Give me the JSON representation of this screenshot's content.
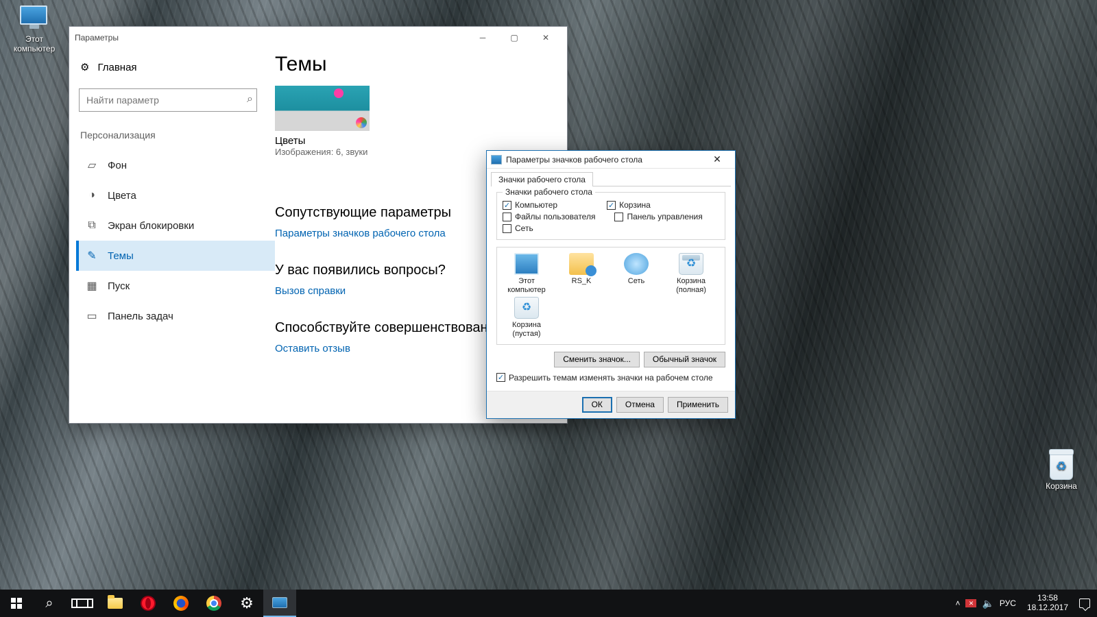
{
  "desktop": {
    "this_pc": "Этот\nкомпьютер",
    "recycle": "Корзина"
  },
  "settings": {
    "title": "Параметры",
    "home": "Главная",
    "search_placeholder": "Найти параметр",
    "category": "Персонализация",
    "nav": {
      "background": "Фон",
      "colors": "Цвета",
      "lockscreen": "Экран блокировки",
      "themes": "Темы",
      "start": "Пуск",
      "taskbar": "Панель задач"
    },
    "main": {
      "heading": "Темы",
      "theme_name": "Цветы",
      "theme_sub": "Изображения: 6, звуки",
      "related_h": "Сопутствующие параметры",
      "related_link": "Параметры значков рабочего стола",
      "help_h": "У вас появились вопросы?",
      "help_link": "Вызов справки",
      "feedback_h": "Способствуйте совершенствованию…",
      "feedback_link": "Оставить отзыв"
    }
  },
  "dialog": {
    "title": "Параметры значков рабочего стола",
    "tab": "Значки рабочего стола",
    "group_title": "Значки рабочего стола",
    "checks": {
      "computer": "Компьютер",
      "recycle": "Корзина",
      "userfiles": "Файлы пользователя",
      "cpl": "Панель управления",
      "network": "Сеть"
    },
    "icons": {
      "pc": "Этот\nкомпьютер",
      "user": "RS_K",
      "net": "Сеть",
      "bin_full": "Корзина\n(полная)",
      "bin_empty": "Корзина\n(пустая)"
    },
    "btn_change": "Сменить значок...",
    "btn_default": "Обычный значок",
    "allow_themes": "Разрешить темам изменять значки на рабочем столе",
    "ok": "ОК",
    "cancel": "Отмена",
    "apply": "Применить"
  },
  "taskbar": {
    "lang": "РУС",
    "time": "13:58",
    "date": "18.12.2017"
  }
}
